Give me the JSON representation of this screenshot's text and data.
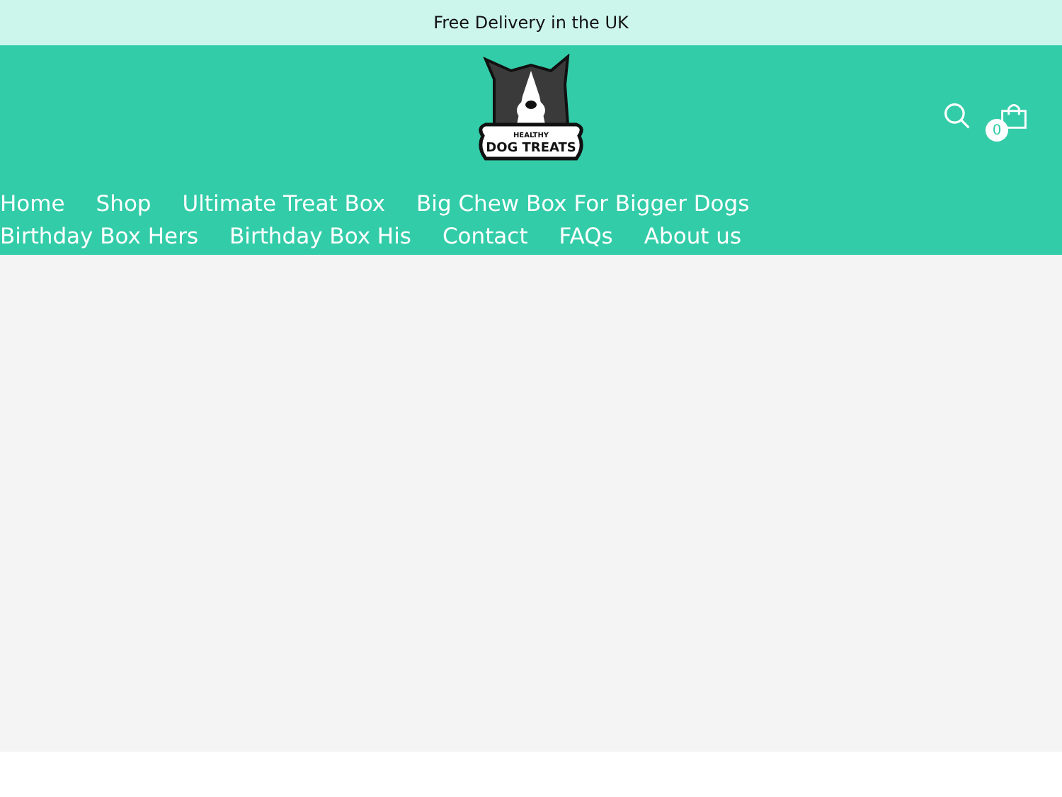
{
  "announcement": "Free Delivery in the UK",
  "logo": {
    "small_text": "HEALTHY",
    "text": "DOG TREATS"
  },
  "cart": {
    "count": "0"
  },
  "nav": [
    {
      "label": "Home"
    },
    {
      "label": "Shop"
    },
    {
      "label": "Ultimate Treat Box"
    },
    {
      "label": "Big Chew Box For Bigger Dogs"
    },
    {
      "label": "Birthday Box Hers"
    },
    {
      "label": "Birthday Box His"
    },
    {
      "label": "Contact"
    },
    {
      "label": "FAQs"
    },
    {
      "label": "About us"
    }
  ]
}
